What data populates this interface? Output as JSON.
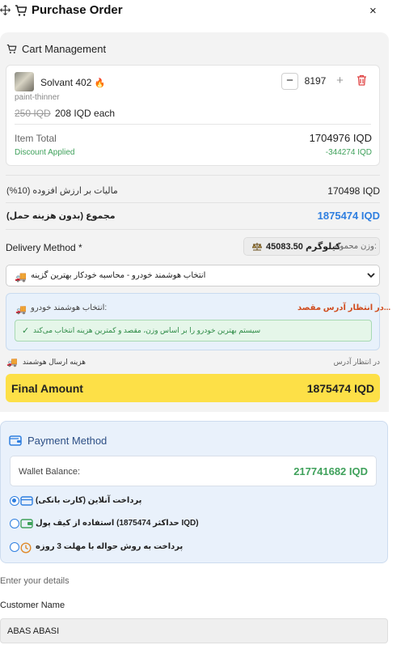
{
  "header": {
    "title": "Purchase Order",
    "close_glyph": "×"
  },
  "cart": {
    "title": "Cart Management",
    "item": {
      "name": "Solvant 402",
      "category": "paint-thinner",
      "price_old": "250 IQD",
      "price_each": "208 IQD each",
      "quantity": "8197",
      "item_total_label": "Item Total",
      "item_total": "1704976 IQD",
      "discount_label": "Discount Applied",
      "discount": "-344274 IQD"
    },
    "vat_label": "مالیات بر ارزش افزوده (10%)",
    "vat_value": "170498 IQD",
    "subtotal_label": "مجموع (بدون هزینه حمل)",
    "subtotal_value": "1875474 IQD"
  },
  "delivery": {
    "label": "Delivery Method *",
    "weight_label": "وزن محموله:",
    "weight_value": "45083.50 کیلوگرم",
    "selected_option": "انتخاب هوشمند خودرو - محاسبه خودکار بهترین گزینه",
    "smart_selection_label": "انتخاب هوشمند خودرو:",
    "awaiting": "در انتظار آدرس مقصد...",
    "smart_note": "سیستم بهترین خودرو را بر اساس وزن، مقصد و کمترین هزینه انتخاب می‌کند",
    "shipping_label": "هزینه ارسال هوشمند",
    "shipping_value": "در انتظار آدرس"
  },
  "final": {
    "label": "Final Amount",
    "value": "1875474 IQD"
  },
  "payment": {
    "title": "Payment Method",
    "wallet_label": "Wallet Balance:",
    "wallet_value": "217741682 IQD",
    "options": [
      {
        "label": "پرداخت آنلاین (کارت بانکی)",
        "icon": "credit-card-icon",
        "selected": true
      },
      {
        "label": "استفاده از کیف پول (حداکثر 1875474 IQD)",
        "icon": "wallet-icon",
        "selected": false
      },
      {
        "label": "پرداخت به روش حواله با مهلت 3 روزه",
        "icon": "clock-icon",
        "selected": false
      }
    ]
  },
  "details": {
    "title": "Enter your details",
    "customer_name_label": "Customer Name",
    "customer_name_value": "ABAS ABASI"
  },
  "colors": {
    "accent_blue": "#2f7fe0",
    "discount_green": "#3fa15b",
    "warning_orange": "#d04b1c",
    "final_yellow": "#fde047",
    "trash_red": "#e04545"
  }
}
